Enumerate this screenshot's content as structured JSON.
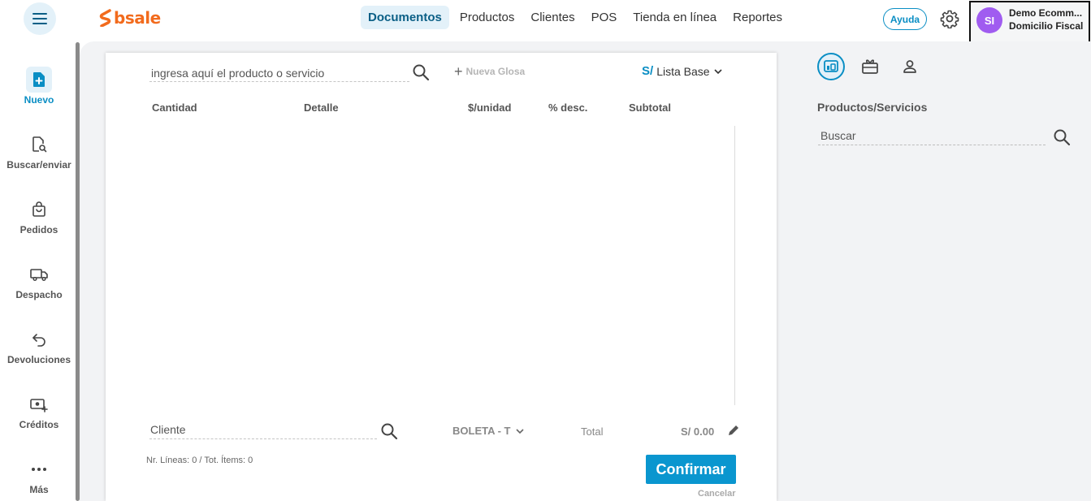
{
  "app": {
    "logo_text": "bsale",
    "brand_color": "#f26b1d",
    "accent_color": "#0a8ec4"
  },
  "header": {
    "menu_icon": "hamburger-icon",
    "nav": [
      {
        "label": "Documentos",
        "active": true
      },
      {
        "label": "Productos",
        "active": false
      },
      {
        "label": "Clientes",
        "active": false
      },
      {
        "label": "POS",
        "active": false
      },
      {
        "label": "Tienda en línea",
        "active": false
      },
      {
        "label": "Reportes",
        "active": false
      }
    ],
    "help_label": "Ayuda",
    "settings_icon": "gear-icon",
    "account": {
      "initials": "SI",
      "name": "Demo Ecomm...",
      "branch": "Domicilio Fiscal",
      "avatar_color": "#a05cf0"
    }
  },
  "sidebar": {
    "items": [
      {
        "label": "Nuevo",
        "icon": "new-document-icon",
        "active": true
      },
      {
        "label": "Buscar/enviar",
        "icon": "document-search-icon",
        "active": false
      },
      {
        "label": "Pedidos",
        "icon": "shopping-bag-icon",
        "active": false
      },
      {
        "label": "Despacho",
        "icon": "truck-icon",
        "active": false
      },
      {
        "label": "Devoluciones",
        "icon": "return-arrow-icon",
        "active": false
      },
      {
        "label": "Créditos",
        "icon": "money-add-icon",
        "active": false
      },
      {
        "label": "Más",
        "icon": "more-dots-icon",
        "active": false
      }
    ]
  },
  "document": {
    "product_placeholder": "ingresa aquí el producto o servicio",
    "new_glosa_label": "Nueva Glosa",
    "currency_symbol": "S/",
    "price_list": "Lista Base",
    "columns": [
      "Cantidad",
      "Detalle",
      "$/unidad",
      "% desc.",
      "Subtotal"
    ],
    "client_placeholder": "Cliente",
    "doc_type": "BOLETA - T",
    "total_label": "Total",
    "total_value": "S/ 0.00",
    "counts": "Nr. Líneas: 0 / Tot. Ítems: 0",
    "confirm_label": "Confirmar",
    "cancel_label": "Cancelar"
  },
  "right_panel": {
    "tabs": [
      {
        "icon": "products-icon",
        "active": true
      },
      {
        "icon": "gift-card-icon",
        "active": false
      },
      {
        "icon": "user-icon",
        "active": false
      }
    ],
    "title": "Productos/Servicios",
    "search_placeholder": "Buscar"
  }
}
